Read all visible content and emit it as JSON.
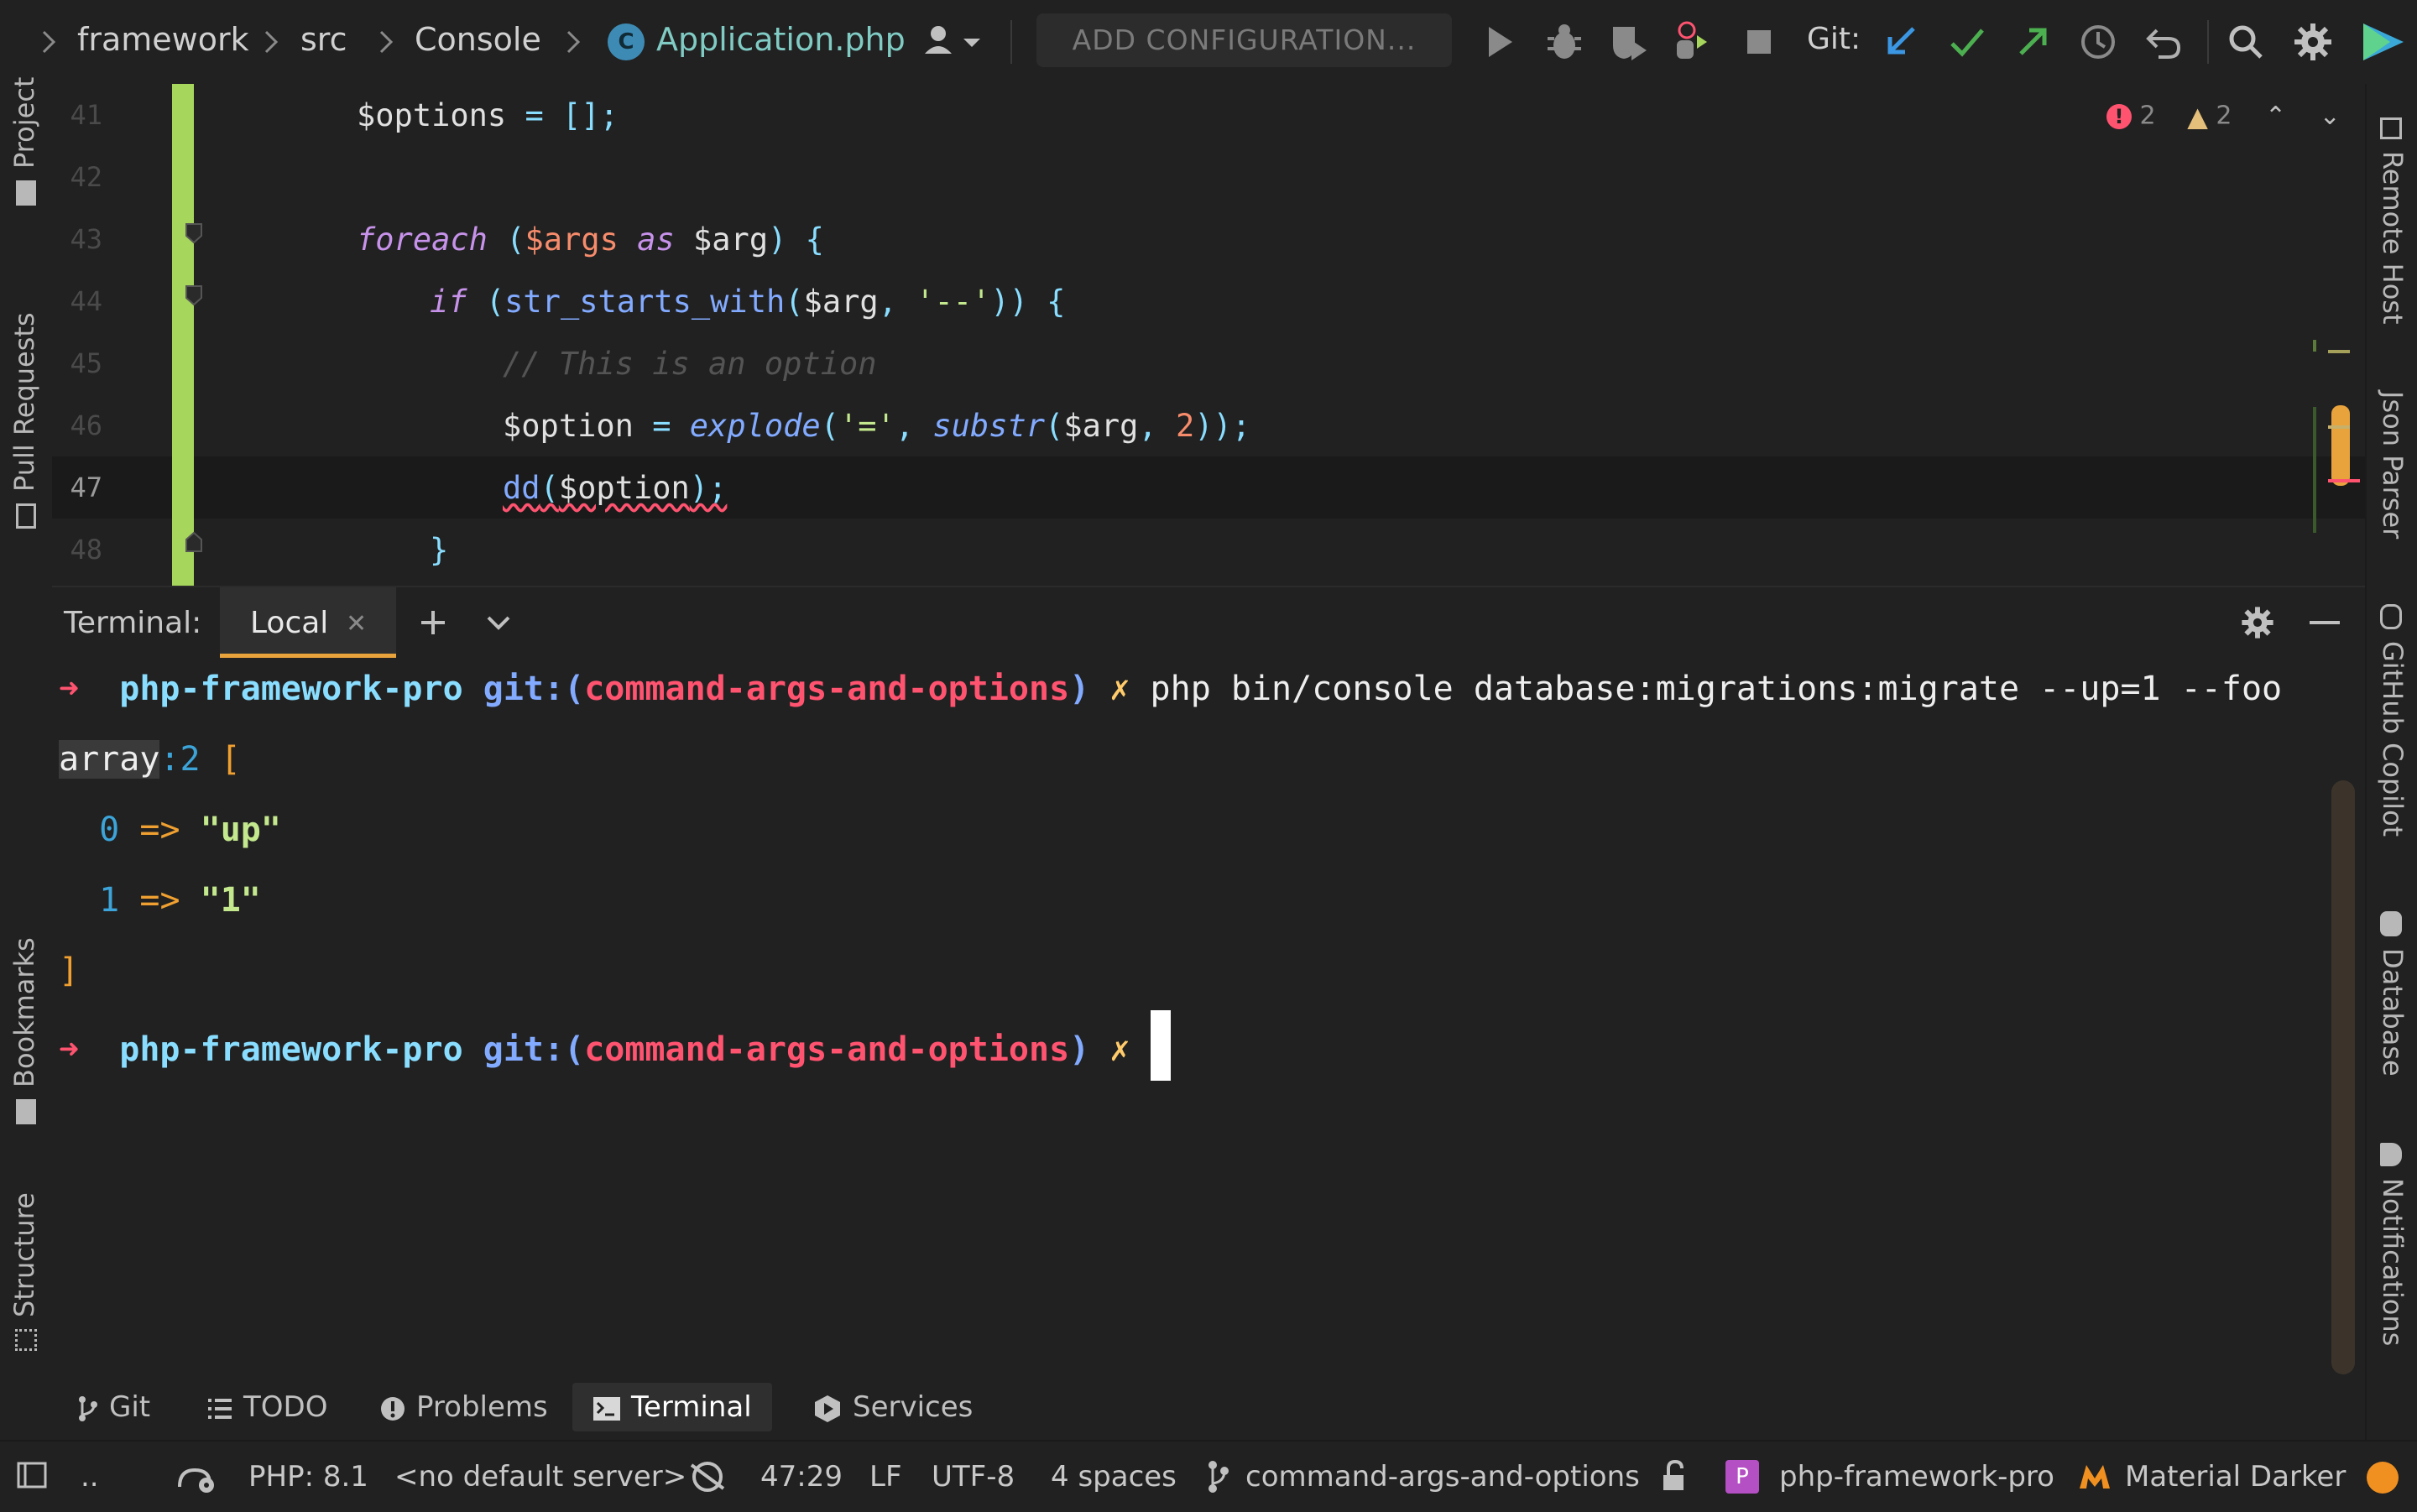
{
  "navbar": {
    "breadcrumbs": [
      "framework",
      "src",
      "Console"
    ],
    "file_badge": "C",
    "file": "Application.php",
    "add_configuration": "ADD CONFIGURATION...",
    "git_label": "Git:"
  },
  "left_tools": [
    "Project",
    "Pull Requests",
    "Bookmarks",
    "Structure"
  ],
  "right_tools": [
    "Remote Host",
    "Json Parser",
    "GitHub Copilot",
    "Database",
    "Notifications"
  ],
  "inspections": {
    "errors": "2",
    "warnings": "2"
  },
  "editor": {
    "line_numbers": [
      "41",
      "42",
      "43",
      "44",
      "45",
      "46",
      "47",
      "48"
    ],
    "l41": {
      "a": "$options",
      "b": " = ",
      "c": "[];"
    },
    "l43": {
      "kw": "foreach",
      "p1": " (",
      "v1": "$args",
      "kw2": " as ",
      "v2": "$arg",
      "p2": ") {"
    },
    "l44": {
      "kw": "if",
      "p1": " (",
      "fn": "str_starts_with",
      "p2": "(",
      "v": "$arg",
      "c": ", ",
      "s": "'--'",
      "p3": ")) {"
    },
    "l45": {
      "cmt": "// This is an option"
    },
    "l46": {
      "v": "$option",
      "eq": " = ",
      "fn1": "explode",
      "p1": "(",
      "s": "'='",
      "c": ", ",
      "fn2": "substr",
      "p2": "(",
      "v2": "$arg",
      "c2": ", ",
      "n": "2",
      "p3": "));"
    },
    "l47": {
      "fn": "dd",
      "p1": "(",
      "v": "$option",
      "p2": ");"
    },
    "l48": {
      "br": "}"
    }
  },
  "terminal": {
    "title": "Terminal:",
    "tab": "Local",
    "arrow": "➜",
    "dir": "php-framework-pro",
    "git": "git:(",
    "branch": "command-args-and-options",
    "git_close": ")",
    "dirty": "✗",
    "command": "php bin/console database:migrations:migrate --up=1 --foo",
    "array_type": "array",
    "array_count": ":2",
    "open_bracket": "[",
    "items": [
      {
        "key": "0",
        "arrow": "=>",
        "value": "\"up\""
      },
      {
        "key": "1",
        "arrow": "=>",
        "value": "\"1\""
      }
    ],
    "close_bracket": "]"
  },
  "bottom_tabs": [
    "Git",
    "TODO",
    "Problems",
    "Terminal",
    "Services"
  ],
  "status": {
    "dots": "..",
    "php": "PHP: 8.1",
    "server": "<no default server>",
    "position": "47:29",
    "line_sep": "LF",
    "encoding": "UTF-8",
    "indent": "4 spaces",
    "branch": "command-args-and-options",
    "project_badge": "P",
    "project": "php-framework-pro",
    "theme": "Material Darker"
  },
  "colors": {
    "accent": "#e8a33c",
    "gutter_added": "#a6d65c",
    "error": "#ff5370"
  }
}
